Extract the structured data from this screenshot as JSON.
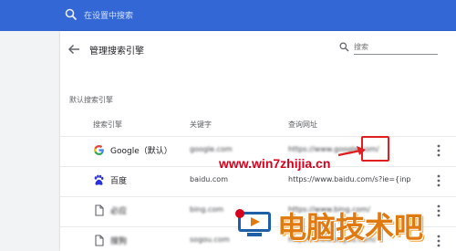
{
  "header": {
    "search_placeholder": "在设置中搜索"
  },
  "page": {
    "title": "管理搜索引擎",
    "search_placeholder": "搜索",
    "section_label": "默认搜索引擎"
  },
  "columns": {
    "engine": "搜索引擎",
    "keyword": "关键字",
    "url": "查询网址"
  },
  "rows": [
    {
      "icon": "google-icon",
      "name": "Google（默认）",
      "keyword": "google.com",
      "url": "https://www.google.com/",
      "name_obscured": false,
      "keyword_obscured": true,
      "url_obscured": true
    },
    {
      "icon": "baidu-paw-icon",
      "name": "百度",
      "keyword": "baidu.com",
      "url": "https://www.baidu.com/s?ie={inputE",
      "name_obscured": false,
      "keyword_obscured": false,
      "url_obscured": false
    },
    {
      "icon": "document-icon",
      "name": "必应",
      "keyword": "bing.com",
      "url": "https://www.bing.com/",
      "name_obscured": true,
      "keyword_obscured": true,
      "url_obscured": true
    },
    {
      "icon": "document-icon",
      "name": "搜狗",
      "keyword": "sogou.com",
      "url": "https://www.sogou.com/",
      "name_obscured": true,
      "keyword_obscured": true,
      "url_obscured": true
    }
  ],
  "watermark": {
    "url": "www.win7zhijia.cn",
    "brand": "电脑技术吧"
  },
  "colors": {
    "topbar": "#3367d6",
    "highlight": "#e02020",
    "watermark_url": "#d6001c",
    "watermark_brand": "#e07a10"
  }
}
